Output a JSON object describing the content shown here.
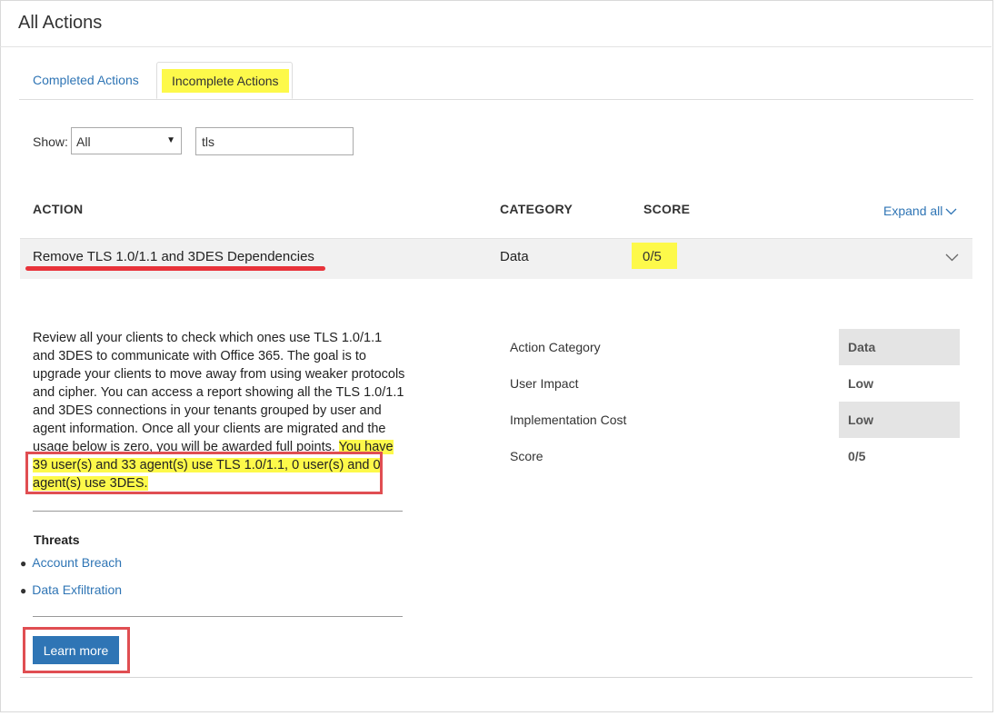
{
  "page": {
    "title": "All Actions"
  },
  "tabs": [
    {
      "label": "Completed Actions",
      "active": false
    },
    {
      "label": "Incomplete Actions",
      "active": true
    }
  ],
  "filter": {
    "show_label": "Show:",
    "select_value": "All",
    "search_value": "tls"
  },
  "table": {
    "headers": {
      "action": "ACTION",
      "category": "CATEGORY",
      "score": "SCORE"
    },
    "expand_all": "Expand all",
    "row": {
      "title": "Remove TLS 1.0/1.1 and 3DES Dependencies",
      "category": "Data",
      "score": "0/5"
    }
  },
  "details": {
    "description": "Review all your clients to check which ones use TLS 1.0/1.1 and 3DES to communicate with Office 365. The goal is to upgrade your clients to move away from using weaker protocols and cipher. You can access a report showing all the TLS 1.0/1.1 and 3DES connections in your tenants grouped by user and agent information. Once all your clients are migrated and the usage below is zero, you will be awarded full points.",
    "highlight": "You have 39 user(s) and 33 agent(s) use TLS 1.0/1.1, 0 user(s) and 0 agent(s) use 3DES.",
    "threats_title": "Threats",
    "threats": [
      "Account Breach",
      "Data Exfiltration"
    ],
    "learn_more": "Learn more",
    "attributes": [
      {
        "label": "Action Category",
        "value": "Data"
      },
      {
        "label": "User Impact",
        "value": "Low"
      },
      {
        "label": "Implementation Cost",
        "value": "Low"
      },
      {
        "label": "Score",
        "value": "0/5"
      }
    ]
  },
  "colors": {
    "accent": "#2f75b5",
    "highlight": "#fdf94a",
    "annotation": "#e04e52"
  }
}
